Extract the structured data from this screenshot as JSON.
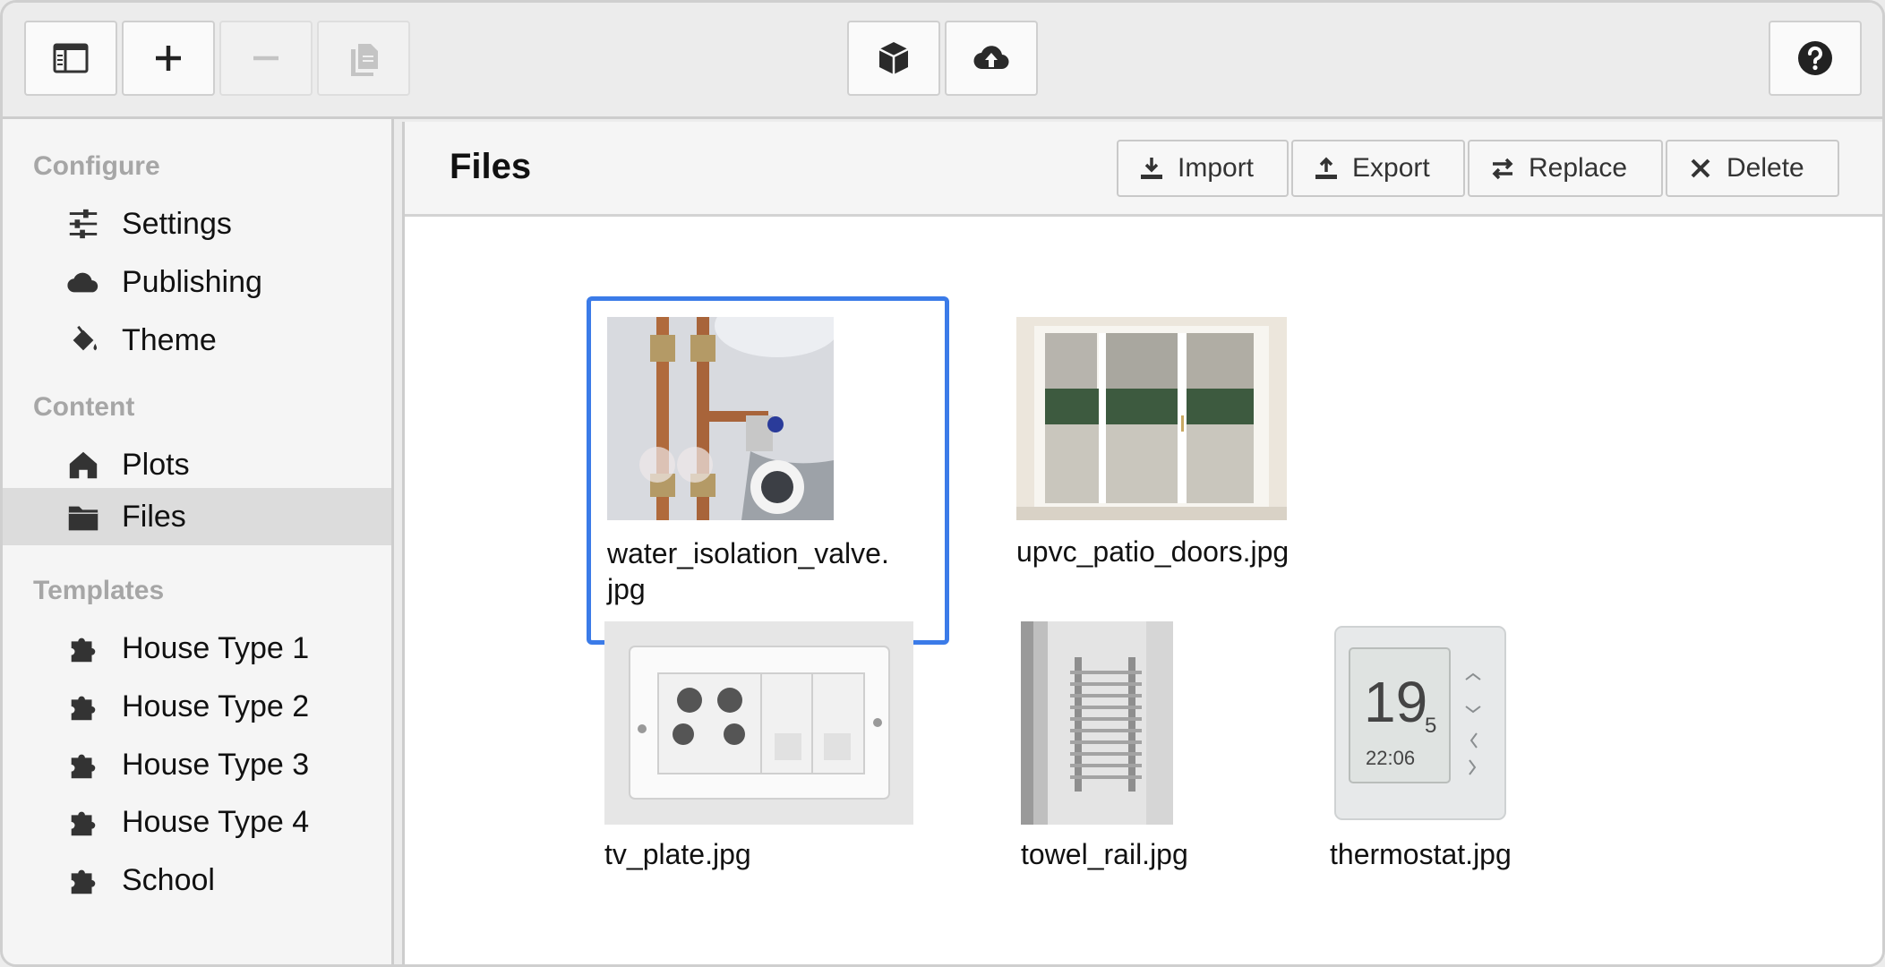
{
  "toolbar": {
    "left_buttons": [
      {
        "icon": "sidebar-toggle-icon",
        "enabled": true
      },
      {
        "icon": "plus-icon",
        "enabled": true
      },
      {
        "icon": "minus-icon",
        "enabled": false
      },
      {
        "icon": "copy-icon",
        "enabled": false
      }
    ],
    "center_buttons": [
      {
        "icon": "cube-icon"
      },
      {
        "icon": "cloud-upload-icon"
      }
    ],
    "right_buttons": [
      {
        "icon": "help-icon"
      }
    ]
  },
  "sidebar": {
    "sections": [
      {
        "title": "Configure",
        "items": [
          {
            "label": "Settings",
            "icon": "sliders-icon"
          },
          {
            "label": "Publishing",
            "icon": "cloud-icon"
          },
          {
            "label": "Theme",
            "icon": "paint-bucket-icon"
          }
        ]
      },
      {
        "title": "Content",
        "items": [
          {
            "label": "Plots",
            "icon": "house-icon"
          },
          {
            "label": "Files",
            "icon": "folder-icon",
            "active": true
          }
        ]
      },
      {
        "title": "Templates",
        "items": [
          {
            "label": "House Type 1",
            "icon": "puzzle-icon"
          },
          {
            "label": "House Type 2",
            "icon": "puzzle-icon"
          },
          {
            "label": "House Type 3",
            "icon": "puzzle-icon"
          },
          {
            "label": "House Type 4",
            "icon": "puzzle-icon"
          },
          {
            "label": "School",
            "icon": "puzzle-icon"
          }
        ]
      }
    ]
  },
  "main": {
    "title": "Files",
    "actions": [
      {
        "label": "Import",
        "icon": "download-icon"
      },
      {
        "label": "Export",
        "icon": "upload-icon"
      },
      {
        "label": "Replace",
        "icon": "swap-icon"
      },
      {
        "label": "Delete",
        "icon": "close-icon"
      }
    ],
    "files": [
      {
        "name": "water_isolation_valve.jpg",
        "name_line1": "water_isolation_valve.",
        "name_line2": "jpg",
        "selected": true
      },
      {
        "name": "upvc_patio_doors.jpg",
        "selected": false
      },
      {
        "name": "tv_plate.jpg",
        "selected": false
      },
      {
        "name": "towel_rail.jpg",
        "selected": false
      },
      {
        "name": "thermostat.jpg",
        "selected": false
      }
    ],
    "thermostat_display": {
      "temp": "19",
      "decimal": "5",
      "time": "22:06"
    }
  },
  "colors": {
    "accent": "#3b7be8",
    "sidebar_bg": "#f5f5f5",
    "active_item_bg": "#dcdcdc",
    "section_title": "#a6a6a6"
  }
}
